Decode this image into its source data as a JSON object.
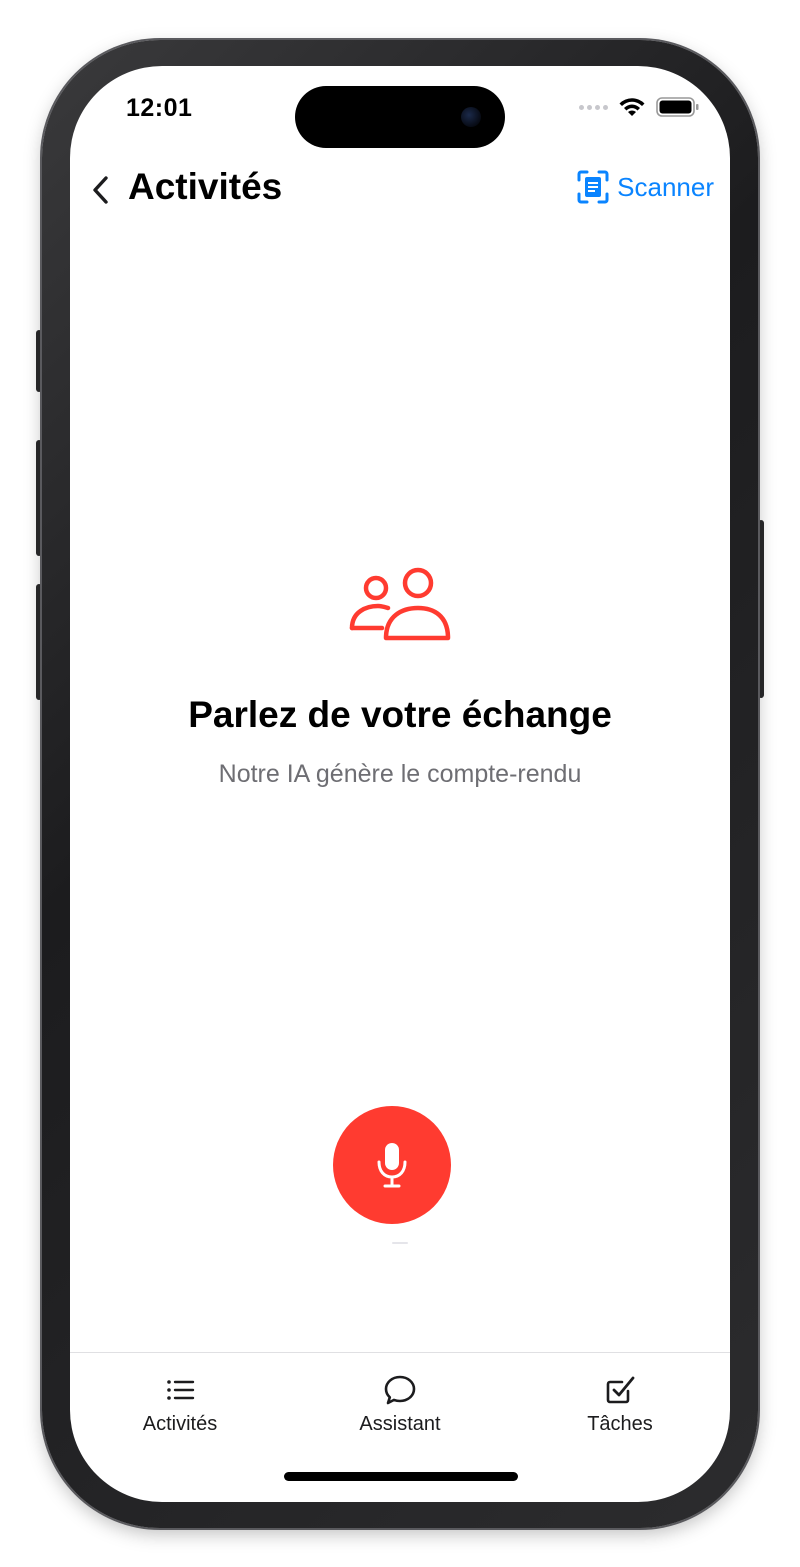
{
  "status_bar": {
    "time": "12:01"
  },
  "nav": {
    "title": "Activités",
    "scanner_label": "Scanner"
  },
  "hero": {
    "title": "Parlez de votre échange",
    "subtitle": "Notre IA génère le compte-rendu"
  },
  "tabs": [
    {
      "label": "Activités",
      "icon": "list-icon"
    },
    {
      "label": "Assistant",
      "icon": "chat-bubble-icon"
    },
    {
      "label": "Tâches",
      "icon": "checkbox-icon"
    }
  ],
  "colors": {
    "accent_red": "#ff3b30",
    "link_blue": "#0a84ff",
    "subtitle_gray": "#6e6e73"
  }
}
